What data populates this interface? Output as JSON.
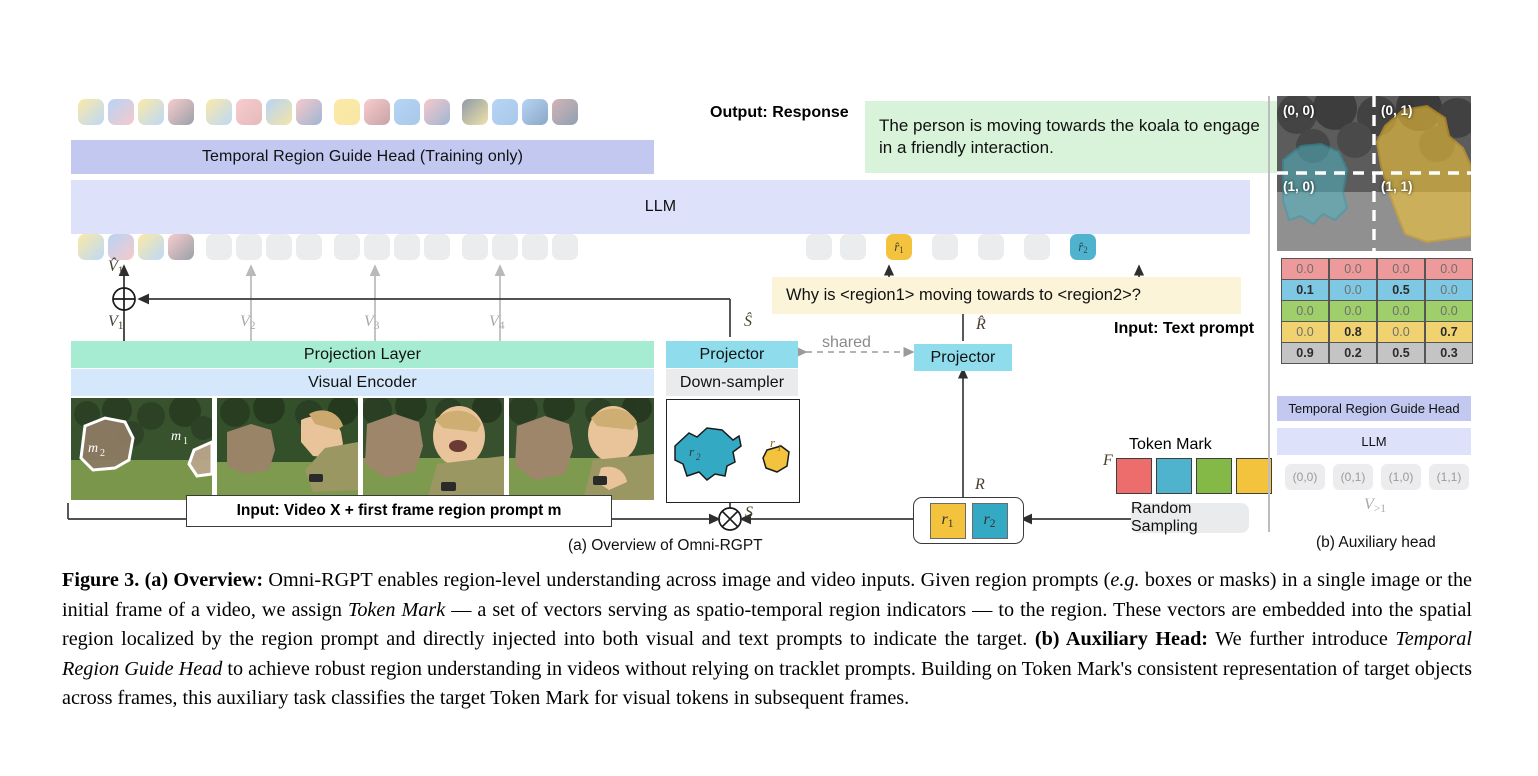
{
  "figure": {
    "number": "Figure 3.",
    "subcaption_a": "(a) Overview of Omni-RGPT",
    "subcaption_b": "(b) Auxiliary head",
    "caption_html": "<b>Figure 3.</b> <b>(a) Overview:</b> Omni-RGPT enables region-level understanding across image and video inputs. Given region prompts (<i>e.g.</i> boxes or masks) in a single image or the initial frame of a video, we assign <i>Token Mark</i> — a set of vectors serving as spatio-temporal region indicators — to the region. These vectors are embedded into the spatial region localized by the region prompt and directly injected into both visual and text prompts to indicate the target. <b>(b) Auxiliary Head:</b> We further introduce <i>Temporal Region Guide Head</i> to achieve robust region understanding in videos without relying on tracklet prompts. Building on Token Mark's consistent representation of target objects across frames, this auxiliary task classifies the target Token Mark for visual tokens in subsequent frames."
  },
  "panel_a": {
    "temporal_region_guide_head": "Temporal Region Guide Head (Training only)",
    "llm": "LLM",
    "projection_layer": "Projection Layer",
    "visual_encoder": "Visual Encoder",
    "projector_left": "Projector",
    "down_sampler": "Down-sampler",
    "projector_right": "Projector",
    "shared_label": "shared",
    "output_label": "Output: Response",
    "response_text": "The person is moving towards the koala to engage in a friendly interaction.",
    "text_prompt": "Why is <region1> moving towards to <region2>?",
    "input_text_prompt_label": "Input: Text prompt",
    "input_video_label": "Input: Video X + first frame region prompt m",
    "token_mark_label": "Token Mark",
    "random_sampling_label": "Random Sampling",
    "math": {
      "v_hat_1": "V̂1",
      "v1": "V1",
      "v2": "V2",
      "v3": "V3",
      "v4": "V4",
      "s_hat": "Ŝ",
      "s": "S",
      "r_hat": "R̂",
      "r": "R",
      "f": "F",
      "m1": "m1",
      "m2": "m2",
      "r1": "r1",
      "r2": "r2",
      "rhat1": "r̂1",
      "rhat2": "r̂2"
    },
    "output_tokens": [
      {
        "type": "grad",
        "c1": "#fbe9a8",
        "c2": "#bcd9f6"
      },
      {
        "type": "grad",
        "c1": "#b7d4f5",
        "c2": "#f6c9cb"
      },
      {
        "type": "grad",
        "c1": "#fbe9a8",
        "c2": "#bcd9f6"
      },
      {
        "type": "grad",
        "c1": "#f8cccd",
        "c2": "#9aa0a8"
      },
      {
        "type": "grad",
        "c1": "#fbe9a8",
        "c2": "#bcd9f6"
      },
      {
        "type": "grad",
        "c1": "#f8cccd",
        "c2": "#e6b9bb"
      },
      {
        "type": "grad",
        "c1": "#b7d4f5",
        "c2": "#f3e5a6"
      },
      {
        "type": "grad",
        "c1": "#f6c9cb",
        "c2": "#9fb6d2"
      },
      {
        "type": "grad",
        "c1": "#fbe9a8",
        "c2": "#f8e7a3"
      },
      {
        "type": "grad",
        "c1": "#f8cccd",
        "c2": "#c6a3a6"
      },
      {
        "type": "grad",
        "c1": "#b7d4f5",
        "c2": "#a8c8ea"
      },
      {
        "type": "grad",
        "c1": "#f6c9cb",
        "c2": "#9fb6d2"
      },
      {
        "type": "grad",
        "c1": "#8f9aa6",
        "c2": "#efe3a8"
      },
      {
        "type": "grad",
        "c1": "#b7d4f5",
        "c2": "#a8c8ea"
      },
      {
        "type": "grad",
        "c1": "#b7d4f5",
        "c2": "#8aa7c8"
      },
      {
        "type": "grad",
        "c1": "#d3b4b6",
        "c2": "#8fa0b2"
      }
    ],
    "input_tokens": [
      {
        "type": "grad",
        "c1": "#fbe9a8",
        "c2": "#bcd9f6"
      },
      {
        "type": "grad",
        "c1": "#b7d4f5",
        "c2": "#f6c9cb"
      },
      {
        "type": "grad",
        "c1": "#fbe9a8",
        "c2": "#bcd9f6"
      },
      {
        "type": "grad",
        "c1": "#f8cccd",
        "c2": "#9aa0a8"
      },
      {
        "type": "gray"
      },
      {
        "type": "gray"
      },
      {
        "type": "gray"
      },
      {
        "type": "gray"
      },
      {
        "type": "gray"
      },
      {
        "type": "gray"
      },
      {
        "type": "gray"
      },
      {
        "type": "gray"
      },
      {
        "type": "gray"
      },
      {
        "type": "gray"
      },
      {
        "type": "gray"
      },
      {
        "type": "gray"
      }
    ],
    "text_tokens": [
      {
        "type": "gray"
      },
      {
        "type": "gray"
      },
      {
        "type": "yellow",
        "label": "r̂1"
      },
      {
        "type": "gray"
      },
      {
        "type": "gray"
      },
      {
        "type": "gray"
      },
      {
        "type": "teal",
        "label": "r̂2"
      }
    ],
    "token_mark_colors": [
      "#ec6d6b",
      "#4fb3ce",
      "#84b947",
      "#f3c33e"
    ],
    "region_chip_colors": {
      "r1": "#f3c33e",
      "r2": "#34a9c4"
    }
  },
  "panel_b": {
    "quadrant_labels": [
      "(0, 0)",
      "(0, 1)",
      "(1, 0)",
      "(1, 1)"
    ],
    "matrix": {
      "row_colors": [
        "#ef9a9a",
        "#7ec8e3",
        "#9fcf6a",
        "#f0d270",
        "#c4c4c4"
      ],
      "rows": [
        [
          "0.0",
          "0.0",
          "0.0",
          "0.0"
        ],
        [
          "0.1",
          "0.0",
          "0.5",
          "0.0"
        ],
        [
          "0.0",
          "0.0",
          "0.0",
          "0.0"
        ],
        [
          "0.0",
          "0.8",
          "0.0",
          "0.7"
        ],
        [
          "0.9",
          "0.2",
          "0.5",
          "0.3"
        ]
      ],
      "bold": [
        [
          false,
          false,
          false,
          false
        ],
        [
          true,
          false,
          true,
          false
        ],
        [
          false,
          false,
          false,
          false
        ],
        [
          false,
          true,
          false,
          true
        ],
        [
          true,
          true,
          true,
          true
        ]
      ]
    },
    "temporal_region_guide_head": "Temporal Region Guide Head",
    "llm": "LLM",
    "visual_tokens": [
      "(0,0)",
      "(0,1)",
      "(1,0)",
      "(1,1)"
    ],
    "v_label": "V>1"
  }
}
